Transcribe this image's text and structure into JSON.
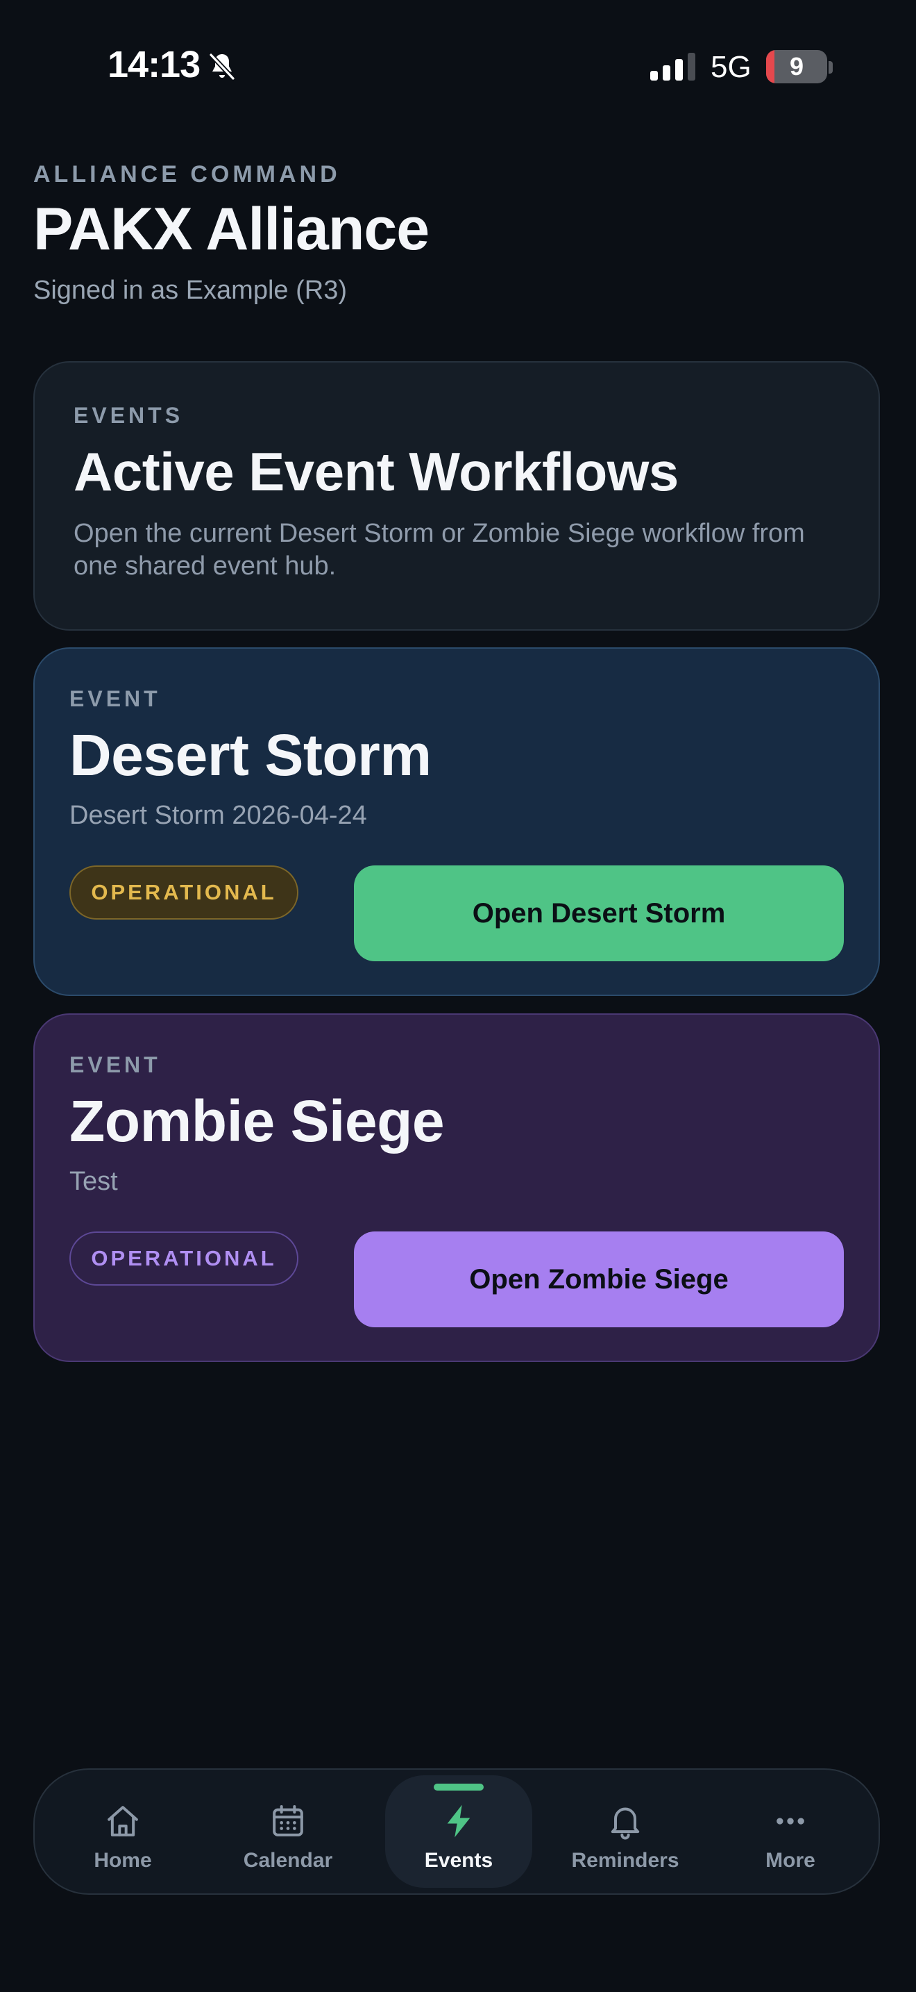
{
  "status_bar": {
    "time": "14:13",
    "network": "5G",
    "battery_level": "9"
  },
  "header": {
    "eyebrow": "ALLIANCE COMMAND",
    "title": "PAKX Alliance",
    "signed_in": "Signed in as Example (R3)"
  },
  "intro_card": {
    "eyebrow": "EVENTS",
    "title": "Active Event Workflows",
    "description": "Open the current Desert Storm or Zombie Siege workflow from one shared event hub."
  },
  "events": [
    {
      "eyebrow": "EVENT",
      "title": "Desert Storm",
      "subtitle": "Desert Storm 2026-04-24",
      "status": "OPERATIONAL",
      "button_label": "Open Desert Storm",
      "accent_color": "#4fc486"
    },
    {
      "eyebrow": "EVENT",
      "title": "Zombie Siege",
      "subtitle": "Test",
      "status": "OPERATIONAL",
      "button_label": "Open Zombie Siege",
      "accent_color": "#a67ff0"
    }
  ],
  "nav": {
    "items": [
      {
        "label": "Home",
        "icon": "home-icon"
      },
      {
        "label": "Calendar",
        "icon": "calendar-icon"
      },
      {
        "label": "Events",
        "icon": "lightning-icon",
        "active": true
      },
      {
        "label": "Reminders",
        "icon": "bell-icon"
      },
      {
        "label": "More",
        "icon": "more-icon"
      }
    ]
  }
}
